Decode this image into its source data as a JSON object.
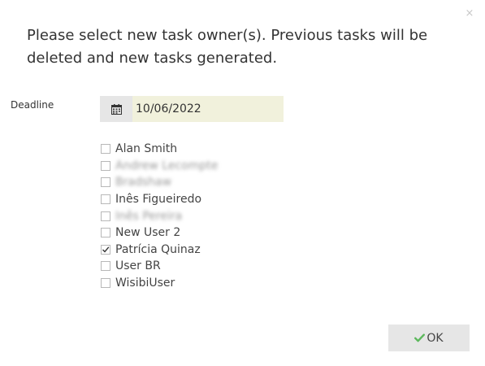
{
  "dialog": {
    "close_glyph": "×",
    "message": "Please select new task owner(s). Previous tasks will be deleted and new tasks generated.",
    "deadline_label": "Deadline",
    "deadline_value": "10/06/2022",
    "calendar_icon": "calendar-icon",
    "owners": [
      {
        "name": "Alan Smith",
        "checked": false,
        "blurred": false
      },
      {
        "name": "Andrew Lecompte",
        "checked": false,
        "blurred": true
      },
      {
        "name": "Bradshaw",
        "checked": false,
        "blurred": true
      },
      {
        "name": "Inês Figueiredo",
        "checked": false,
        "blurred": false
      },
      {
        "name": "Inês Pereira",
        "checked": false,
        "blurred": true
      },
      {
        "name": "New User 2",
        "checked": false,
        "blurred": false
      },
      {
        "name": "Patrícia Quinaz",
        "checked": true,
        "blurred": false
      },
      {
        "name": "User BR",
        "checked": false,
        "blurred": false
      },
      {
        "name": "WisibiUser",
        "checked": false,
        "blurred": false
      }
    ],
    "ok_label": "OK",
    "ok_icon": "check-icon",
    "ok_icon_color": "#5cb85c"
  }
}
